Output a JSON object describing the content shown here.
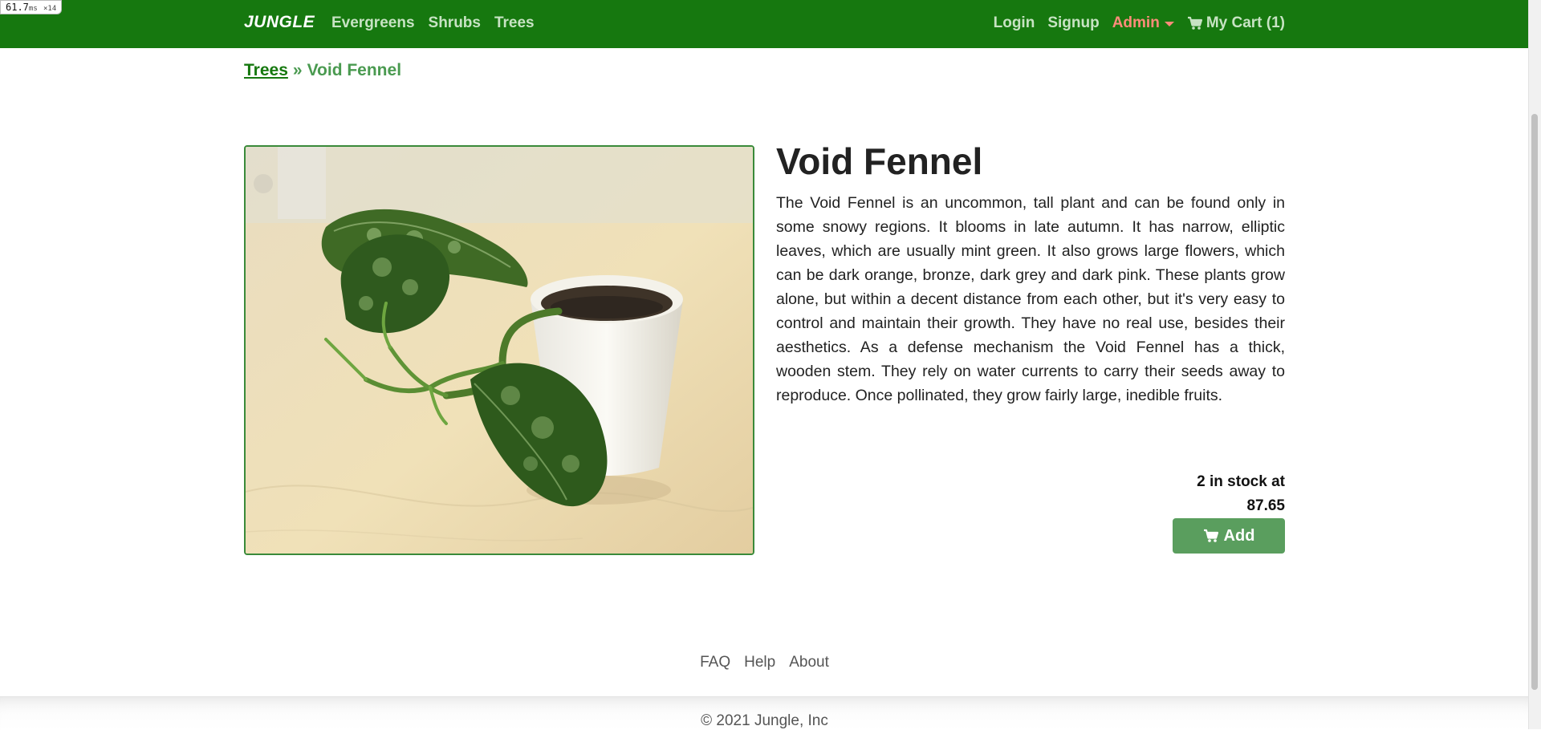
{
  "debug": {
    "timing": "61.7",
    "unit": "ms",
    "multiplier": "×14"
  },
  "nav": {
    "brand": "JUNGLE",
    "links": [
      "Evergreens",
      "Shrubs",
      "Trees"
    ],
    "login": "Login",
    "signup": "Signup",
    "admin": "Admin",
    "cart": "My Cart (1)"
  },
  "breadcrumb": {
    "parent": "Trees",
    "separator": "»",
    "current": "Void Fennel"
  },
  "product": {
    "name": "Void Fennel",
    "description": "The Void Fennel is an uncommon, tall plant and can be found only in some snowy regions. It blooms in late autumn. It has narrow, elliptic leaves, which are usually mint green. It also grows large flowers, which can be dark orange, bronze, dark grey and dark pink. These plants grow alone, but within a decent distance from each other, but it's very easy to control and maintain their growth. They have no real use, besides their aesthetics. As a defense mechanism the Void Fennel has a thick, wooden stem. They rely on water currents to carry their seeds away to reproduce. Once pollinated, they grow fairly large, inedible fruits.",
    "stock_line": "2 in stock at",
    "price": "87.65",
    "add_label": "Add"
  },
  "footer": {
    "links": [
      "FAQ",
      "Help",
      "About"
    ],
    "copyright": "© 2021 Jungle, Inc"
  },
  "colors": {
    "navbar": "#16780f",
    "nav_link": "#c7e3c3",
    "admin": "#ff8c7a",
    "add_button": "#5a9e5e",
    "breadcrumb_current": "#4a9a50"
  },
  "icons": {
    "cart": "cart-icon",
    "dropdown": "caret-down-icon"
  }
}
